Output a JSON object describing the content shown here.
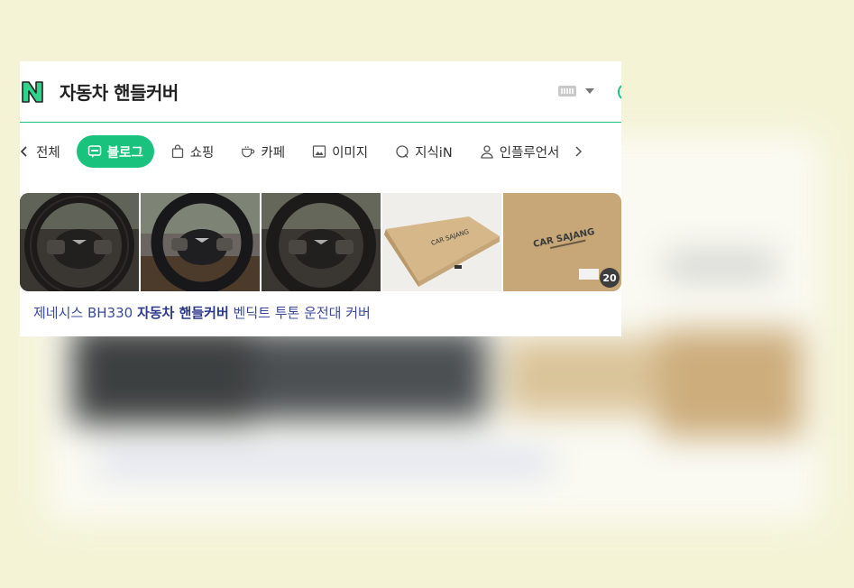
{
  "search": {
    "query": "자동차 핸들커버"
  },
  "tabs": [
    {
      "label": "전체",
      "icon": "x-icon"
    },
    {
      "label": "블로그",
      "icon": "blog-icon",
      "active": true
    },
    {
      "label": "쇼핑",
      "icon": "shopping-bag-icon"
    },
    {
      "label": "카페",
      "icon": "coffee-cup-icon"
    },
    {
      "label": "이미지",
      "icon": "image-icon"
    },
    {
      "label": "지식iN",
      "icon": "question-bubble-icon"
    },
    {
      "label": "인플루언서",
      "icon": "person-icon"
    }
  ],
  "result": {
    "image_count": "20",
    "box_label": "CAR SAJANG",
    "title_pre": "제네시스 BH330 ",
    "title_bold": "자동차 핸들커버",
    "title_post": " 벤딕트 투톤 운전대 커버"
  },
  "colors": {
    "accent": "#19c37d",
    "background": "#f4f3d6",
    "link": "#3b4a9e"
  }
}
